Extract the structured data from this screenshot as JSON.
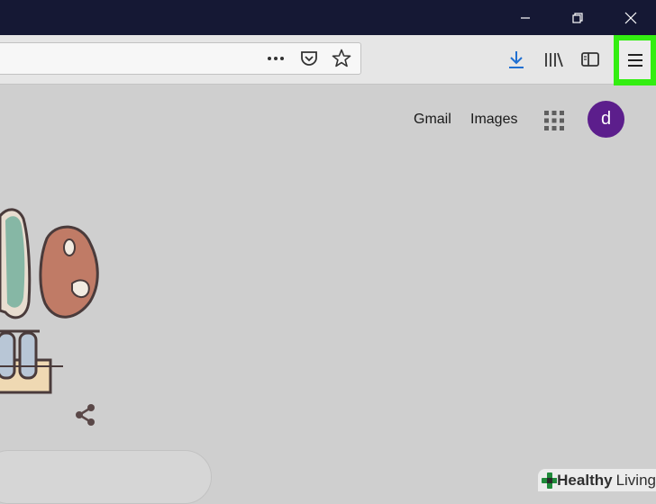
{
  "header": {
    "gmail_label": "Gmail",
    "images_label": "Images",
    "avatar_letter": "d"
  },
  "toolbar": {
    "icons": [
      "more-icon",
      "pocket-icon",
      "bookmark-star-icon",
      "download-icon",
      "library-icon",
      "sidebar-icon",
      "hamburger-menu-icon"
    ],
    "highlight_color": "#33ee11"
  },
  "window_controls": [
    "minimize-icon",
    "restore-icon",
    "close-icon"
  ],
  "watermark": {
    "bold": "Healthy",
    "regular": "Living"
  }
}
